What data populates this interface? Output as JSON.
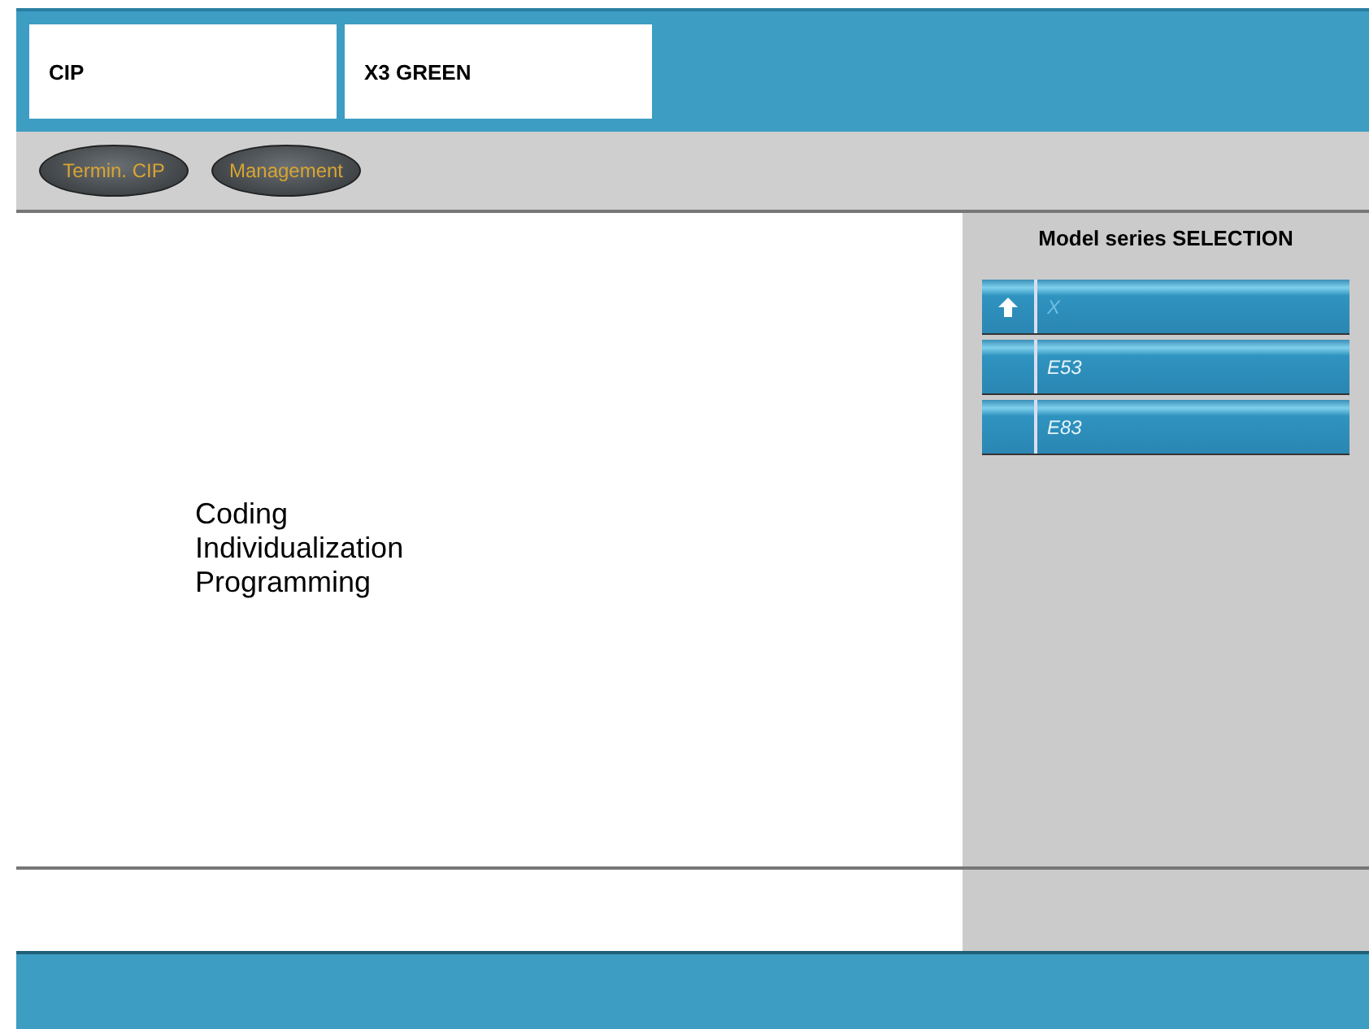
{
  "header": {
    "fields": [
      "CIP",
      "X3 GREEN"
    ]
  },
  "toolbar": {
    "buttons": [
      "Termin. CIP",
      "Management"
    ]
  },
  "main": {
    "lines": [
      "Coding",
      "Individualization",
      "Programming"
    ]
  },
  "selection": {
    "title": "Model series SELECTION",
    "items": [
      {
        "label": "X",
        "kind": "up",
        "disabled": true
      },
      {
        "label": "E53",
        "kind": "plain",
        "disabled": false
      },
      {
        "label": "E83",
        "kind": "plain",
        "disabled": false
      }
    ]
  }
}
